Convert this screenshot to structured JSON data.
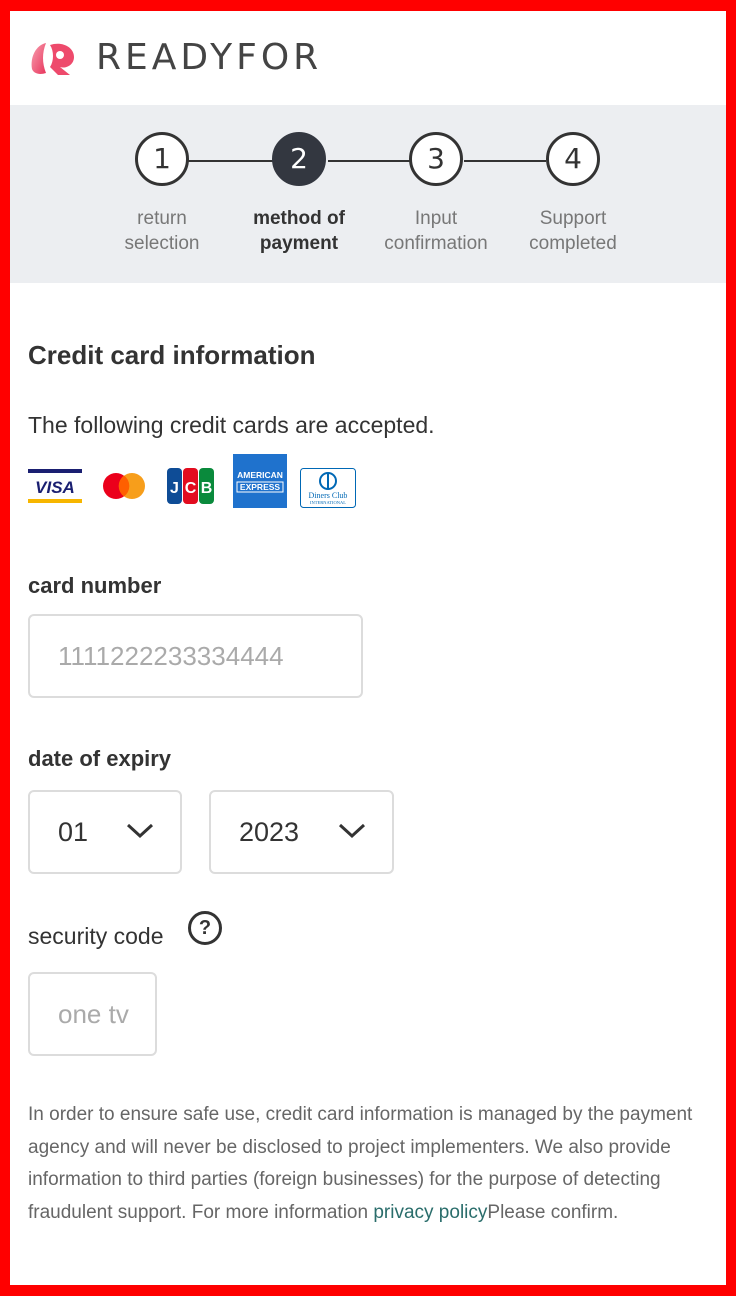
{
  "header": {
    "brand": "READYFOR"
  },
  "steps": [
    {
      "number": "1",
      "label_line1": "return",
      "label_line2": "selection",
      "active": false
    },
    {
      "number": "2",
      "label_line1": "method of",
      "label_line2": "payment",
      "active": true
    },
    {
      "number": "3",
      "label_line1": "Input",
      "label_line2": "confirmation",
      "active": false
    },
    {
      "number": "4",
      "label_line1": "Support",
      "label_line2": "completed",
      "active": false
    }
  ],
  "main": {
    "title": "Credit card information",
    "accepted_text": "The following credit cards are accepted.",
    "cards": [
      "VISA",
      "Mastercard",
      "JCB",
      "AMERICAN EXPRESS",
      "Diners Club INTERNATIONAL"
    ],
    "card_number": {
      "label": "card number",
      "placeholder": "1111222233334444"
    },
    "expiry": {
      "label": "date of expiry",
      "month": "01",
      "year": "2023"
    },
    "security": {
      "label": "security code",
      "help": "?",
      "placeholder": "one tv"
    },
    "notice": {
      "text": "In order to ensure safe use, credit card information is managed by the payment agency and will never be disclosed to project implementers. We also provide information to third parties (foreign businesses) for the purpose of detecting fraudulent support. For more information ",
      "link": "privacy policy",
      "after": "Please confirm."
    }
  },
  "colors": {
    "frame": "#ff0000",
    "stepper_bg": "#eceef1",
    "active_step": "#333740",
    "link": "#2a6d6b"
  }
}
